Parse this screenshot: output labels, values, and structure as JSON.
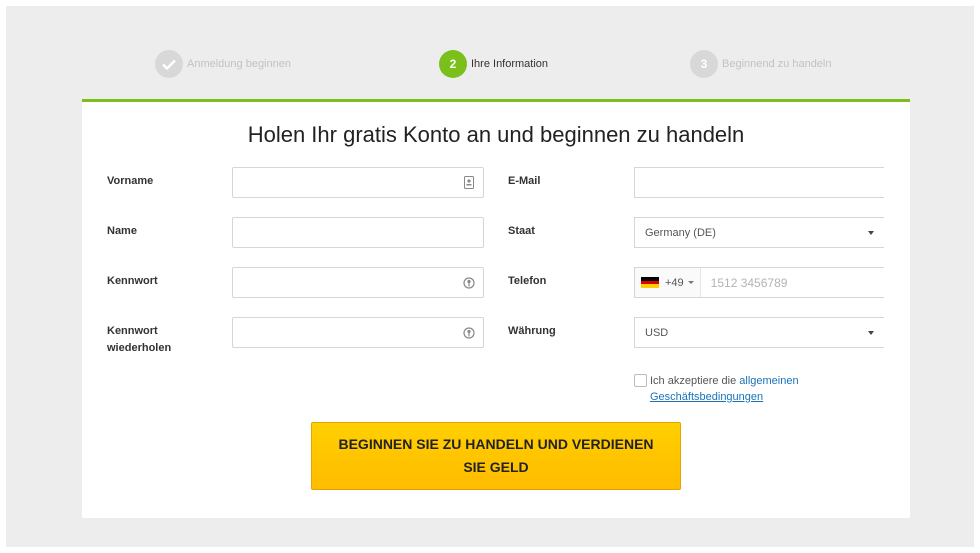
{
  "stepper": {
    "steps": [
      {
        "number": "",
        "label": "Anmeldung beginnen",
        "state": "done"
      },
      {
        "number": "2",
        "label": "Ihre Information",
        "state": "active"
      },
      {
        "number": "3",
        "label": "Beginnend zu handeln",
        "state": "todo"
      }
    ]
  },
  "form": {
    "title": "Holen Ihr gratis Konto an und beginnen zu handeln",
    "first_name_label": "Vorname",
    "last_name_label": "Name",
    "password_label": "Kennwort",
    "password_repeat_label": "Kennwort wiederholen",
    "email_label": "E-Mail",
    "country_label": "Staat",
    "country_value": "Germany (DE)",
    "phone_label": "Telefon",
    "phone_dial_code": "+49",
    "phone_placeholder": "1512 3456789",
    "currency_label": "Währung",
    "currency_value": "USD",
    "terms_prefix": "Ich akzeptiere die",
    "terms_link_part1": "allgemeinen",
    "terms_link_part2": "Geschäftsbedingungen",
    "submit_label": "BEGINNEN SIE ZU HANDELN UND VERDIENEN SIE GELD"
  },
  "colors": {
    "accent_green": "#7bbf1a",
    "cta_yellow": "#ffc400",
    "link_blue": "#1a73b8"
  }
}
